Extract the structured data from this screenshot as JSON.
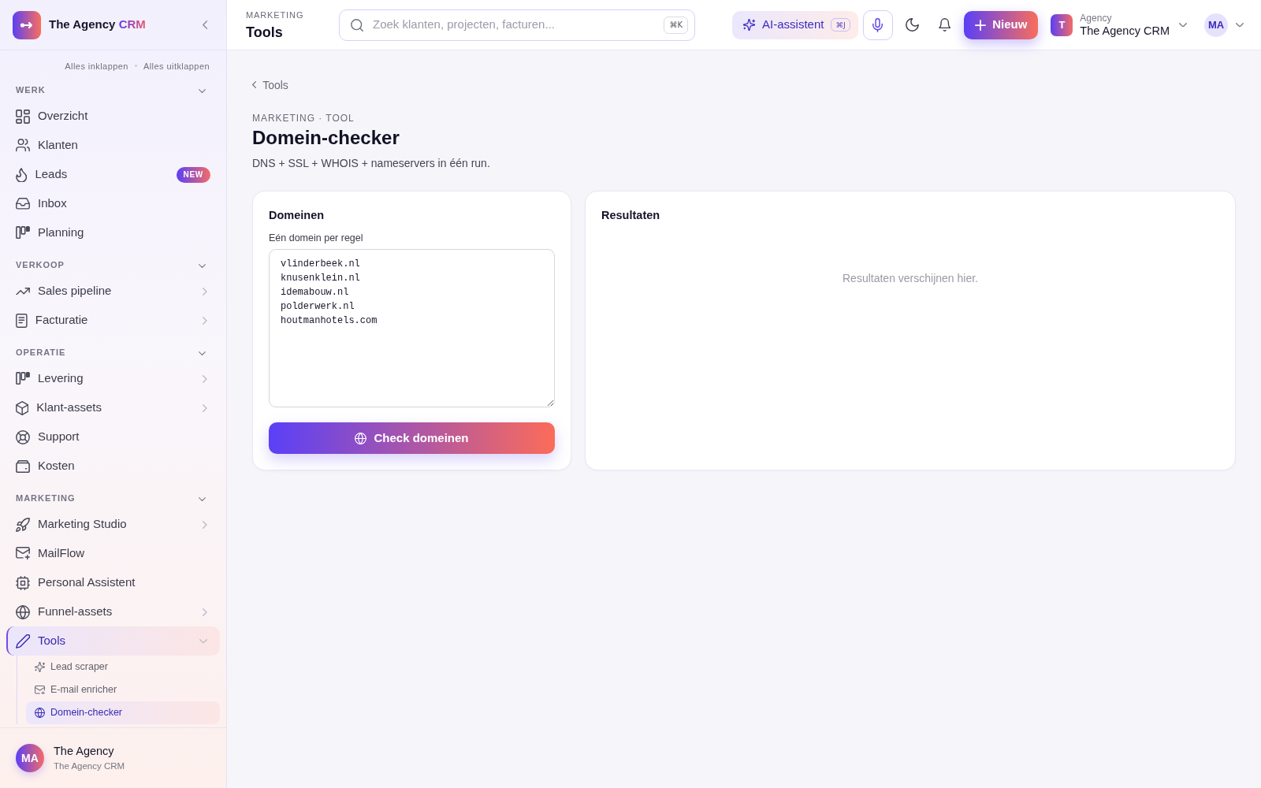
{
  "sidebar": {
    "brand": {
      "name": "The Agency",
      "accent": "CRM"
    },
    "bulk_actions": [
      "Alles inklappen",
      "Alles uitklappen"
    ],
    "sections": [
      {
        "label": "WERK",
        "expanded": true,
        "items": [
          {
            "label": "Overzicht",
            "selected": false
          },
          {
            "label": "Klanten",
            "selected": false
          },
          {
            "label": "Leads",
            "selected": false,
            "badge": "NEW"
          },
          {
            "label": "Inbox",
            "selected": false
          },
          {
            "label": "Planning",
            "selected": false
          }
        ]
      },
      {
        "label": "VERKOOP",
        "expanded": true,
        "items": [
          {
            "label": "Sales pipeline",
            "selected": false,
            "expanded": false
          },
          {
            "label": "Facturatie",
            "selected": false,
            "expanded": false
          }
        ]
      },
      {
        "label": "OPERATIE",
        "expanded": true,
        "items": [
          {
            "label": "Levering",
            "selected": false,
            "expanded": false
          },
          {
            "label": "Klant-assets",
            "selected": false,
            "expanded": false
          },
          {
            "label": "Support",
            "selected": false
          },
          {
            "label": "Kosten",
            "selected": false
          }
        ]
      },
      {
        "label": "MARKETING",
        "expanded": true,
        "items": [
          {
            "label": "Marketing Studio",
            "selected": false,
            "expanded": false
          },
          {
            "label": "MailFlow",
            "selected": false
          },
          {
            "label": "Personal Assistent",
            "selected": false
          },
          {
            "label": "Funnel-assets",
            "selected": false,
            "expanded": false
          },
          {
            "label": "Tools",
            "selected": true,
            "expanded": true,
            "children": [
              {
                "label": "Lead scraper",
                "selected": false
              },
              {
                "label": "E-mail enricher",
                "selected": false
              },
              {
                "label": "Domein-checker",
                "selected": true
              }
            ]
          }
        ]
      }
    ],
    "account": {
      "initials": "MA",
      "name": "The Agency",
      "subtitle": "The Agency CRM"
    }
  },
  "topbar": {
    "eyebrow": "MARKETING",
    "title": "Tools",
    "search": {
      "placeholder": "Zoek klanten, projecten, facturen...",
      "shortcut": "⌘K"
    },
    "assistant": {
      "label": "AI-assistent",
      "shortcut": "⌘J"
    },
    "new_button": {
      "label": "Nieuw"
    },
    "workspace": {
      "initial": "T",
      "caption": "Agency",
      "name": "The Agency CRM"
    },
    "user": {
      "initials": "MA"
    }
  },
  "page": {
    "breadcrumb": "Tools",
    "eyebrow": "MARKETING · TOOL",
    "title": "Domein-checker",
    "subtitle": "DNS + SSL + WHOIS + nameservers in één run.",
    "input_card": {
      "title": "Domeinen",
      "field_label": "Eén domein per regel",
      "domains": [
        "vlinderbeek.nl",
        "knusenklein.nl",
        "idemabouw.nl",
        "polderwerk.nl",
        "houtmanhotels.com"
      ],
      "button": "Check domeinen"
    },
    "results_card": {
      "title": "Resultaten",
      "empty_text": "Resultaten verschijnen hier."
    }
  }
}
